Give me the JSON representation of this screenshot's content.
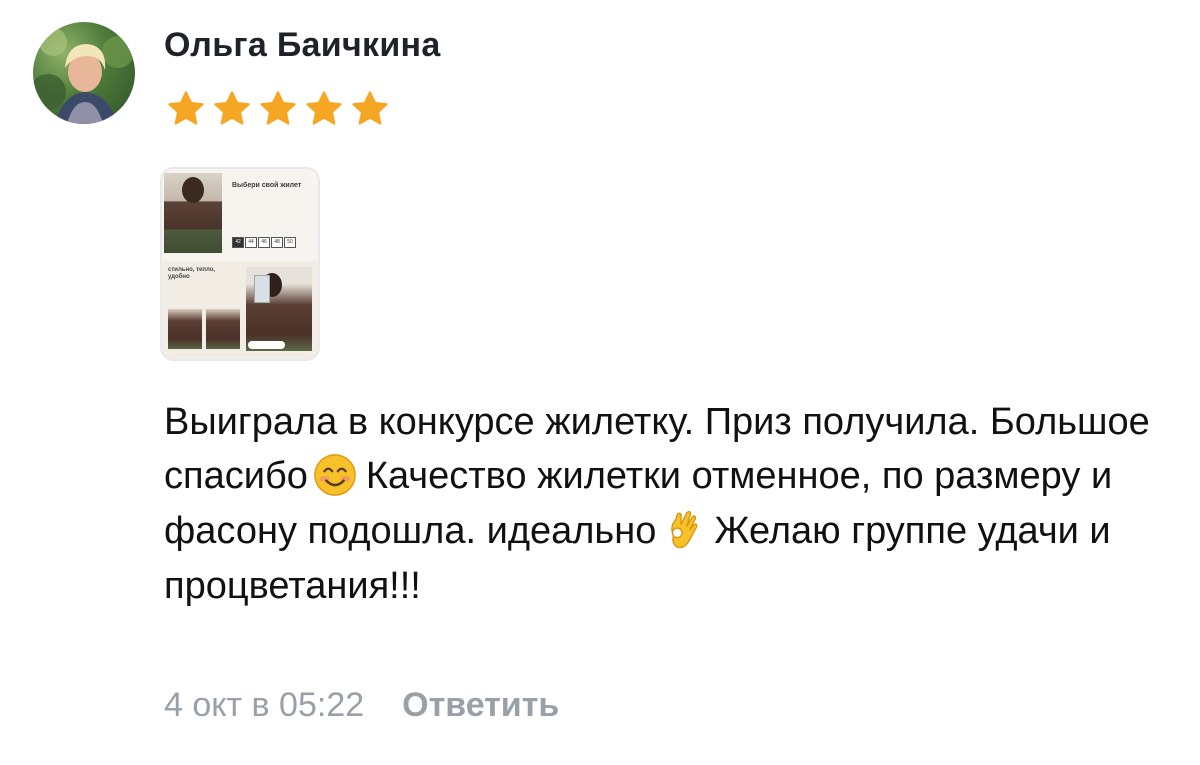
{
  "comment": {
    "author_name": "Ольга Баичкина",
    "rating": 5,
    "rating_max": 5,
    "text_parts": [
      "Выиграла в конкурсе жилетку. Приз получила. Большое спасибо",
      "Качество жилетки отменное, по размеру и фасону подошла. идеально",
      "Желаю группе удачи и процветания!!!"
    ],
    "emojis": [
      "smiling-face-emoji",
      "ok-hand-emoji"
    ],
    "timestamp": "4 окт в 05:22",
    "reply_label": "Ответить"
  },
  "attachment": {
    "title": "Выбери свой жилет",
    "sizes": [
      "42",
      "44",
      "46",
      "48",
      "50"
    ],
    "selected_size": "42",
    "caption": "стильно, тепло, удобно"
  },
  "colors": {
    "star": "#f5a623",
    "meta_text": "#9aa0a8",
    "name_text": "#1f2329"
  }
}
